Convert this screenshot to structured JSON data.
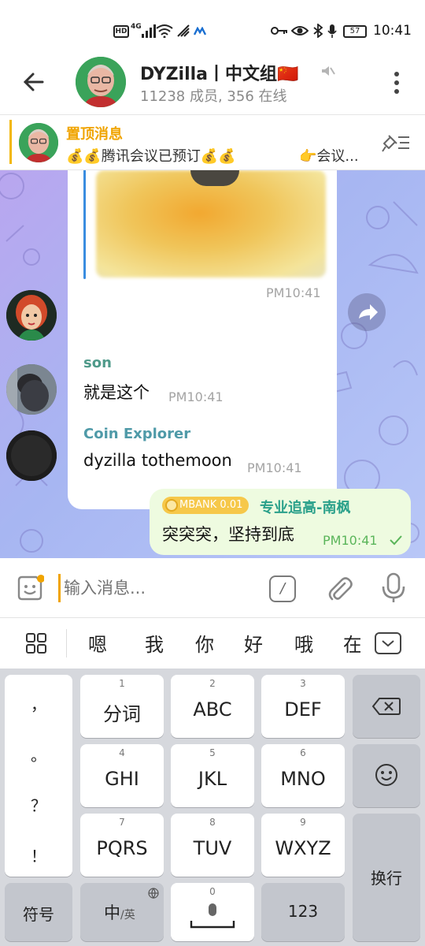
{
  "status_bar": {
    "hd": "HD",
    "network": "4G",
    "battery": "57",
    "time": "10:41"
  },
  "header": {
    "title": "DYZilla丨中文组🇨🇳",
    "subtitle": "11238 成员, 356 在线"
  },
  "pinned": {
    "title": "置顶消息",
    "text": "💰💰腾讯会议已预订💰💰",
    "text_more": "👉会议..."
  },
  "messages": [
    {
      "type": "image",
      "time": "PM10:41"
    },
    {
      "sender": "son",
      "sender_color": "#4f9a8a",
      "text": "就是这个",
      "time": "PM10:41"
    },
    {
      "sender": "Coin Explorer",
      "sender_color": "#4f9aa8",
      "text": "dyzilla tothemoon",
      "time": "PM10:41"
    },
    {
      "tag": "MBANK 0.01",
      "sender": "专业追高-南枫",
      "sender_color": "#2aa08a",
      "text": "突突突，坚持到底",
      "time": "PM10:41",
      "outgoing": true
    }
  ],
  "input": {
    "placeholder": "输入消息..."
  },
  "candidates": [
    "嗯",
    "我",
    "你",
    "好",
    "哦",
    "在"
  ],
  "keyboard": {
    "punctuation": [
      "，",
      "。",
      "？",
      "！"
    ],
    "keys": [
      {
        "num": "1",
        "label": "分词"
      },
      {
        "num": "2",
        "label": "ABC"
      },
      {
        "num": "3",
        "label": "DEF"
      },
      {
        "num": "4",
        "label": "GHI"
      },
      {
        "num": "5",
        "label": "JKL"
      },
      {
        "num": "6",
        "label": "MNO"
      },
      {
        "num": "7",
        "label": "PQRS"
      },
      {
        "num": "8",
        "label": "TUV"
      },
      {
        "num": "9",
        "label": "WXYZ"
      }
    ],
    "symbols": "符号",
    "lang": "中",
    "lang_alt": "/英",
    "space_num": "0",
    "numbers": "123",
    "enter": "换行"
  }
}
